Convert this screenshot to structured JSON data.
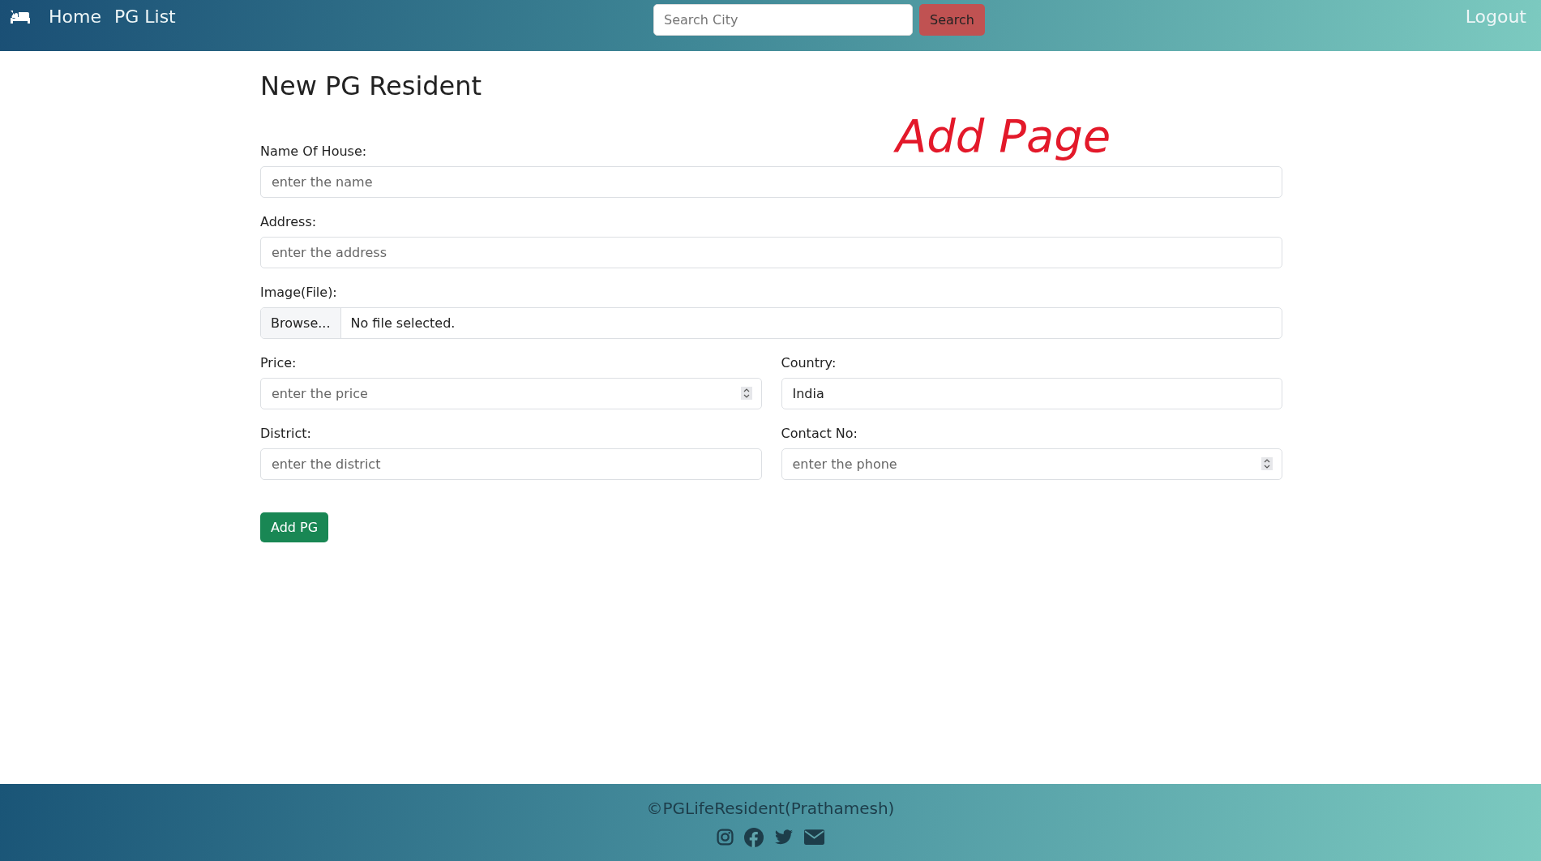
{
  "navbar": {
    "links": [
      "Home",
      "PG List"
    ],
    "search": {
      "placeholder": "Search City",
      "button": "Search"
    },
    "logout": "Logout"
  },
  "page": {
    "title": "New PG Resident",
    "annotation": "Add Page"
  },
  "form": {
    "rows": [
      [
        {
          "kind": "text",
          "label": "Name Of House:",
          "placeholder": "enter the name"
        }
      ],
      [
        {
          "kind": "text",
          "label": "Address:",
          "placeholder": "enter the address"
        }
      ],
      [
        {
          "kind": "file",
          "label": "Image(File):",
          "button": "Browse...",
          "value": "No file selected."
        }
      ],
      [
        {
          "kind": "number",
          "label": "Price:",
          "placeholder": "enter the price"
        },
        {
          "kind": "text",
          "label": "Country:",
          "value": "India"
        }
      ],
      [
        {
          "kind": "text",
          "label": "District:",
          "placeholder": "enter the district"
        },
        {
          "kind": "number",
          "label": "Contact No:",
          "placeholder": "enter the phone"
        }
      ]
    ],
    "submit": "Add PG"
  },
  "footer": {
    "text": "©PGLifeResident(Prathamesh)"
  }
}
